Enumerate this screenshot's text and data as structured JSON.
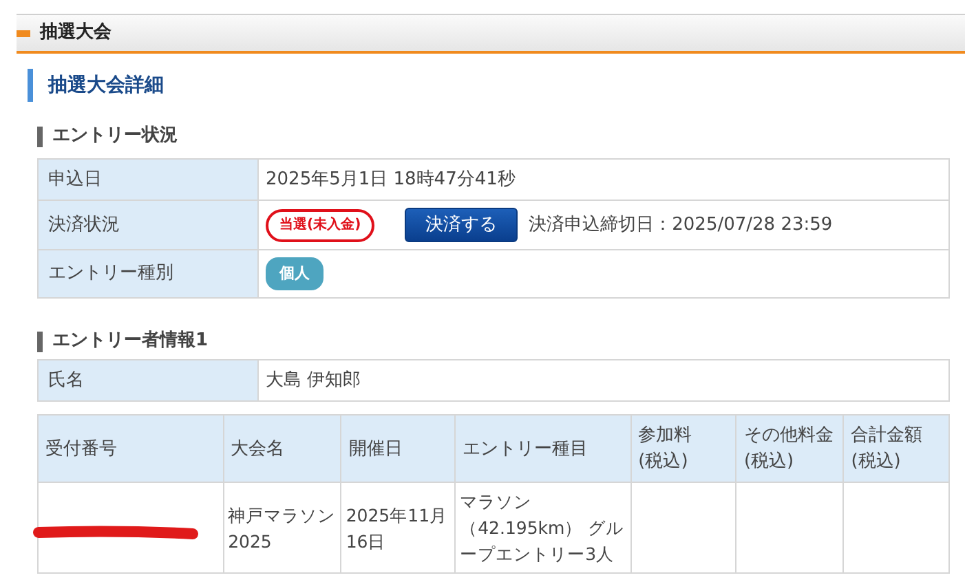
{
  "header": {
    "title": "抽選大会"
  },
  "section_title": "抽選大会詳細",
  "entry_status": {
    "heading": "エントリー状況",
    "rows": [
      {
        "kind": "text",
        "label": "申込日",
        "value": "2025年5月1日 18時47分41秒"
      },
      {
        "kind": "payment",
        "label": "決済状況",
        "status_badge": "当選(未入金)",
        "button": "決済する",
        "deadline": "決済申込締切日：2025/07/28 23:59"
      },
      {
        "kind": "tag",
        "label": "エントリー種別",
        "tag": "個人"
      }
    ]
  },
  "entrant": {
    "heading": "エントリー者情報1",
    "rows": [
      {
        "label": "氏名",
        "value": "大島 伊知郎"
      }
    ]
  },
  "table": {
    "columns": [
      "受付番号",
      "大会名",
      "開催日",
      "エントリー種目",
      "参加料(税込)",
      "その他料金(税込)",
      "合計金額(税込)"
    ],
    "rows": [
      {
        "receipt_redacted": true,
        "cells": [
          "",
          "神戸マラソン2025",
          "2025年11月16日",
          "マラソン（42.195km） グループエントリー3人",
          "",
          "",
          ""
        ]
      }
    ]
  }
}
